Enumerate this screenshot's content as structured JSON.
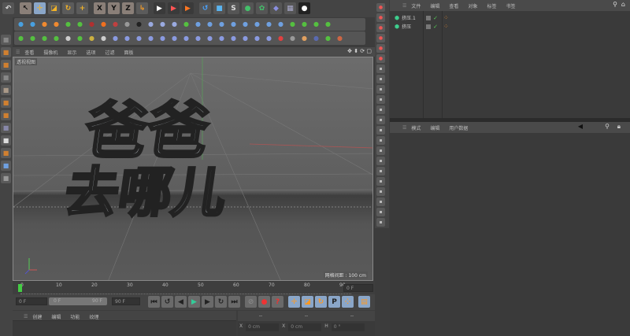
{
  "toolbar_top": {
    "icons": [
      {
        "n": "undo-icon",
        "g": "↶",
        "c": "#ddd",
        "b": "#555"
      },
      {
        "n": "live-select-icon",
        "g": "↖",
        "c": "#111",
        "b": "#8a7f78"
      },
      {
        "n": "move-icon",
        "g": "✛",
        "c": "#f2b328",
        "b": "#8aa6c8"
      },
      {
        "n": "scale-icon",
        "g": "◪",
        "c": "#f2b328",
        "b": "#5b5b5b"
      },
      {
        "n": "rotate-icon",
        "g": "↻",
        "c": "#f2b328",
        "b": "#5b5b5b"
      },
      {
        "n": "recent-tool-icon",
        "g": "+",
        "c": "#f2b328",
        "b": "#5b5b5b"
      },
      {
        "n": "x-axis-icon",
        "g": "X",
        "c": "#111",
        "b": "#8a7f78"
      },
      {
        "n": "y-axis-icon",
        "g": "Y",
        "c": "#111",
        "b": "#8a7f78"
      },
      {
        "n": "z-axis-icon",
        "g": "Z",
        "c": "#111",
        "b": "#8a7f78"
      },
      {
        "n": "coordinate-system-icon",
        "g": "↳",
        "c": "#f29b28",
        "b": "#5b5b5b"
      },
      {
        "n": "render-view-icon",
        "g": "▶",
        "c": "#fff",
        "b": "#3a3a3a"
      },
      {
        "n": "render-picture-viewer-icon",
        "g": "▶",
        "c": "#f55",
        "b": "#3a3a3a"
      },
      {
        "n": "render-settings-icon",
        "g": "▶",
        "c": "#f72",
        "b": "#3a3a3a"
      },
      {
        "n": "spline-pen-icon",
        "g": "↺",
        "c": "#4aa3ff",
        "b": "#555"
      },
      {
        "n": "cube-icon",
        "g": "■",
        "c": "#5ab4f0",
        "b": "#555"
      },
      {
        "n": "subdivision-icon",
        "g": "S",
        "c": "#ddd",
        "b": "#555"
      },
      {
        "n": "array-icon",
        "g": "●",
        "c": "#44c06a",
        "b": "#555"
      },
      {
        "n": "cloner-icon",
        "g": "✿",
        "c": "#44c06a",
        "b": "#555"
      },
      {
        "n": "deformer-icon",
        "g": "◆",
        "c": "#8a8fe0",
        "b": "#555"
      },
      {
        "n": "floor-icon",
        "g": "▦",
        "c": "#aac",
        "b": "#555"
      },
      {
        "n": "camera-icon",
        "g": "●",
        "c": "#fff",
        "b": "#222"
      }
    ]
  },
  "toolbar_row2": [
    "#48a0e0",
    "#48a0e0",
    "#f08a30",
    "#f08a30",
    "#55c040",
    "#55c040",
    "#b03030",
    "#f07020",
    "#c04040",
    "#999",
    "#222",
    "#9aaae0",
    "#9aaae0",
    "#9aaae0",
    "#55c040",
    "#6fa0e0",
    "#6fa0e0",
    "#6fa0e0",
    "#6fa0e0",
    "#6fa0e0",
    "#6fa0e0",
    "#6fa0e0",
    "#6fa0e0",
    "#55c040",
    "#55c040",
    "#55c040",
    "#55c040"
  ],
  "toolbar_row3": [
    "#55c040",
    "#55c040",
    "#55c040",
    "#55c040",
    "#ccc",
    "#55c040",
    "#cbb040",
    "#ccc",
    "#8a9ae0",
    "#8a9ae0",
    "#8a9ae0",
    "#8a9ae0",
    "#8a9ae0",
    "#8a9ae0",
    "#8a9ae0",
    "#8a9ae0",
    "#8a9ae0",
    "#8a9ae0",
    "#8a9ae0",
    "#8a9ae0",
    "#8a9ae0",
    "#8a9ae0",
    "#e04040",
    "#999",
    "#e0a060",
    "#5a6ab0",
    "#55c040",
    "#cc6644"
  ],
  "viewport": {
    "menu": [
      "查看",
      "摄像机",
      "显示",
      "选项",
      "过滤",
      "面板"
    ],
    "label": "透视视图",
    "grid_spacing": "网格间距 : 100 cm",
    "scene_text_line1": "爸爸",
    "scene_text_line2": "去哪儿"
  },
  "object_manager": {
    "menu": [
      "文件",
      "编辑",
      "查看",
      "对象",
      "标签",
      "书签"
    ],
    "objects": [
      {
        "name": "挤压.1"
      },
      {
        "name": "挤压"
      }
    ]
  },
  "attributes": {
    "menu": [
      "模式",
      "编辑",
      "用户数据"
    ]
  },
  "timeline": {
    "ticks": [
      "0",
      "10",
      "20",
      "30",
      "40",
      "50",
      "60",
      "70",
      "80",
      "90"
    ],
    "current_frame": "0 F",
    "start": "0 F",
    "range_start": "0 F",
    "range_end": "90 F",
    "end": "90 F",
    "current": 0,
    "max": 90
  },
  "materials": {
    "menu": [
      "创建",
      "编辑",
      "功能",
      "纹理"
    ]
  },
  "coordinates": {
    "header": [
      "--",
      "--",
      "--"
    ],
    "fields": [
      {
        "axis": "X",
        "value": "0 cm"
      },
      {
        "axis": "X",
        "value": "0 cm"
      },
      {
        "axis": "H",
        "value": "0 °"
      }
    ]
  }
}
